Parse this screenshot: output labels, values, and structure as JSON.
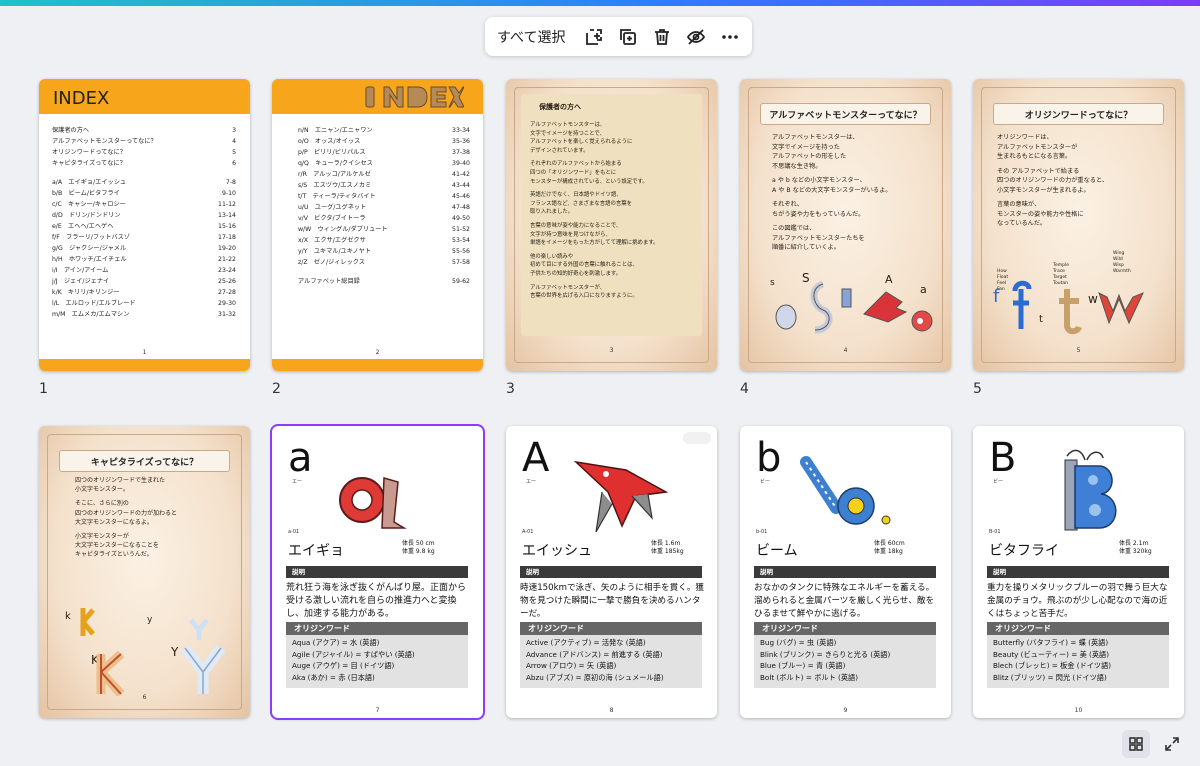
{
  "toolbar": {
    "select_all": "すべて選択",
    "icons": [
      "add-page-icon",
      "duplicate-icon",
      "trash-icon",
      "hide-icon",
      "more-icon"
    ]
  },
  "pages": [
    {
      "num": "1",
      "index_title": "INDEX",
      "footer": "1",
      "rows": [
        [
          "保護者の方へ",
          "3"
        ],
        [
          "アルファベットモンスターってなに？",
          "4"
        ],
        [
          "オリジンワードってなに？",
          "5"
        ],
        [
          "キャピタライズってなに？",
          "6"
        ],
        [
          "",
          ""
        ],
        [
          "a/A　エイギョ/エイッシュ",
          "7-8"
        ],
        [
          "b/B　ビーム/ビタフライ",
          "9-10"
        ],
        [
          "c/C　キャシー/キャロシー",
          "11-12"
        ],
        [
          "d/D　ドリン/ドンドリン",
          "13-14"
        ],
        [
          "e/E　エヘヘ/エヘゲヘ",
          "15-16"
        ],
        [
          "f/F　フラーリ/フットバスゾ",
          "17-18"
        ],
        [
          "g/G　ジャクシー/ジャメル",
          "19-20"
        ],
        [
          "h/H　ホワッチ/エイチェル",
          "21-22"
        ],
        [
          "i/I　アイン/アイーム",
          "23-24"
        ],
        [
          "j/J　ジェイ/ジェナイ",
          "25-26"
        ],
        [
          "k/K　キリリ/キリンジー",
          "27-28"
        ],
        [
          "l/L　エルロッド/エルブレード",
          "29-30"
        ],
        [
          "m/M　エムメカ/エムマシン",
          "31-32"
        ]
      ]
    },
    {
      "num": "2",
      "footer": "2",
      "rows": [
        [
          "n/N　エニャン/エニャワン",
          "33-34"
        ],
        [
          "o/O　オッス/オイッス",
          "35-36"
        ],
        [
          "p/P　ピリリ/ピリパルス",
          "37-38"
        ],
        [
          "q/Q　キューラ/クイシセス",
          "39-40"
        ],
        [
          "r/R　アルッコ/アルケルゼ",
          "41-42"
        ],
        [
          "s/S　エスヅウ/エスノカミ",
          "43-44"
        ],
        [
          "t/T　ティーラ/ティタバイト",
          "45-46"
        ],
        [
          "u/U　ユーグ/ユグネット",
          "47-48"
        ],
        [
          "v/V　ビクタ/ブイトーラ",
          "49-50"
        ],
        [
          "w/W　ウィングル/ダブリュート",
          "51-52"
        ],
        [
          "x/X　エクサ/エグゼクサ",
          "53-54"
        ],
        [
          "y/Y　ユキマル/ユキノヤト",
          "55-56"
        ],
        [
          "z/Z　ゼノ/ジィレックス",
          "57-58"
        ],
        [
          "",
          ""
        ],
        [
          "アルファベット総目録",
          "59-62"
        ]
      ]
    },
    {
      "num": "3",
      "footer": "3",
      "title": "保護者の方へ",
      "lines": [
        "アルファベットモンスターは、",
        "文字でイメージを持つことで、",
        "アルファベットを楽しく覚えられるように",
        "デザインされています。",
        "",
        "それぞれのアルファベットから始まる",
        "四つの「オリジンワード」をもとに",
        "モンスターが構成されている、という設定です。",
        "",
        "英語だけでなく、日本語やドイツ語、",
        "フランス語など、さまざまな言語の言葉を",
        "取り入れました。",
        "",
        "言葉の意味が姿や能力になることで、",
        "文字が持つ意味を見つけながら、",
        "単語をイメージをもった方がしてて理解に挑めます。",
        "",
        "他の楽しい読みや",
        "初めて目にする外国の言葉に触れることは、",
        "子供たちの知的好奇心を刺激します。",
        "",
        "アルファベットモンスターが、",
        "言葉の世界を広げる入口になりますように。"
      ]
    },
    {
      "num": "4",
      "footer": "4",
      "title": "アルファベットモンスターってなに？",
      "lines": [
        "アルファベットモンスターは、",
        "文字でイメージを持った",
        "アルファベットの形をした",
        "不思議な生き物。",
        "",
        "a や b などの小文字モンスター、",
        "A や B などの大文字モンスターがいるよ。",
        "",
        "それぞれ、",
        "ちがう姿や力をもっているんだ。",
        "",
        "この図鑑では、",
        "アルファベットモンスターたちを",
        "順番に紹介していくよ。"
      ],
      "letters": [
        "s",
        "S",
        "A",
        "a"
      ]
    },
    {
      "num": "5",
      "footer": "5",
      "title": "オリジンワードってなに？",
      "lines": [
        "オリジンワードは、",
        "アルファベットモンスターが",
        "生まれるもとになる言葉。",
        "",
        "その アルファベットで始まる",
        "四つのオリジンワードの力が重なると、",
        "小文字モンスターが生まれるよ。",
        "",
        "言葉の意味が、",
        "モンスターの姿や能力や性格に",
        "なっているんだ。"
      ],
      "words_f": [
        "How",
        "Float",
        "Feel",
        "Fan"
      ],
      "words_t": [
        "Temple",
        "Trace",
        "Target",
        "Toutan"
      ],
      "words_w": [
        "Wing",
        "Wild",
        "Wisp",
        "Warmth"
      ],
      "letters": [
        "f",
        "t",
        "w"
      ]
    },
    {
      "num": "6",
      "footer": "6",
      "title": "キャピタライズってなに？",
      "lines": [
        "四つのオリジンワードで生まれた",
        "小文字モンスター。",
        "",
        "そこに、さらに別の",
        "四つのオリジンワードの力が加わると",
        "大文字モンスターになるよ。",
        "",
        "小文字モンスターが",
        "大文字モンスターになることを",
        "キャピタライズというんだ。"
      ],
      "letters": [
        "k",
        "y",
        "K",
        "Y"
      ]
    },
    {
      "num": "7",
      "footer": "7",
      "letter": "a",
      "kana": "エー",
      "id": "a-01",
      "name": "エイギョ",
      "height": "体長 50 cm",
      "weight": "体重 9.8 kg",
      "desc_hdr": "説明",
      "desc": "荒れ狂う海を泳ぎ抜くがんばり屋。正面から受ける激しい流れを自らの推進力へと変換し、加速する能力がある。",
      "orig_hdr": "オリジンワード",
      "orig": [
        "Aqua (アクア) = 水 (英語)",
        "Agile (アジャイル) = すばやい (英語)",
        "Auge (アウゲ) = 目 (ドイツ語)",
        "Aka (あか) = 赤 (日本語)"
      ]
    },
    {
      "num": "8",
      "footer": "8",
      "letter": "A",
      "kana": "エー",
      "id": "A-01",
      "name": "エイッシュ",
      "height": "体長 1.6m",
      "weight": "体重 185kg",
      "desc_hdr": "説明",
      "desc": "時速150kmで泳ぎ、矢のように相手を貫く。獲物を見つけた瞬間に一撃で勝負を決めるハンターだ。",
      "orig_hdr": "オリジンワード",
      "orig": [
        "Active (アクティブ) = 活発な (英語)",
        "Advance (アドバンス) = 前進する (英語)",
        "Arrow (アロウ) = 矢 (英語)",
        "Abzu (アブズ) = 原初の海 (シュメール語)"
      ]
    },
    {
      "num": "9",
      "footer": "9",
      "letter": "b",
      "kana": "ビー",
      "id": "b-01",
      "name": "ビーム",
      "height": "体長 60cm",
      "weight": "体重 18kg",
      "desc_hdr": "説明",
      "desc": "おなかのタンクに特殊なエネルギーを蓄える。溜められると金属パーツを厳しく光らせ、敵をひるませて鮮やかに逃げる。",
      "orig_hdr": "オリジンワード",
      "orig": [
        "Bug (バグ) = 虫 (英語)",
        "Blink (ブリンク) = きらりと光る (英語)",
        "Blue (ブルー) = 青 (英語)",
        "Bolt (ボルト) = ボルト (英語)"
      ]
    },
    {
      "num": "10",
      "footer": "10",
      "letter": "B",
      "kana": "ビー",
      "id": "B-01",
      "name": "ビタフライ",
      "height": "体長 2.1m",
      "weight": "体重 320kg",
      "desc_hdr": "説明",
      "desc": "重力を操りメタリックブルーの羽で舞う巨大な金属のチョウ。飛ぶのが少し心配なので海の近くはちょっと苦手だ。",
      "orig_hdr": "オリジンワード",
      "orig": [
        "Butterfly (バタフライ) = 蝶 (英語)",
        "Beauty (ビューティー) = 美 (英語)",
        "Blech (ブレッヒ) = 板金 (ドイツ語)",
        "Blitz (ブリッツ) = 閃光 (ドイツ語)"
      ]
    }
  ],
  "colors": {
    "accent": "#8b3dff",
    "index_orange": "#f7a61c"
  },
  "bottom_tools": [
    "grid-view-icon",
    "fullscreen-icon"
  ]
}
